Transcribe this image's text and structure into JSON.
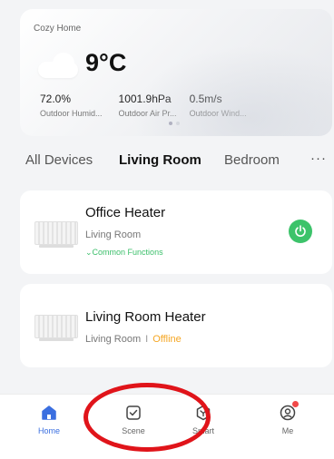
{
  "weather": {
    "home_name": "Cozy Home",
    "temperature": "9°C",
    "icon": "cloud-icon",
    "stats": [
      {
        "value": "72.0%",
        "label": "Outdoor Humid..."
      },
      {
        "value": "1001.9hPa",
        "label": "Outdoor Air Pr..."
      },
      {
        "value": "0.5m/s",
        "label": "Outdoor Wind..."
      }
    ]
  },
  "tabs": {
    "items": [
      "All Devices",
      "Living Room",
      "Bedroom"
    ],
    "active": "Living Room",
    "more": "···"
  },
  "devices": [
    {
      "name": "Office Heater",
      "room": "Living Room",
      "extra": "⌄Common Functions",
      "power": "on",
      "power_color": "#3cc36a"
    },
    {
      "name": "Living Room Heater",
      "room": "Living Room",
      "separator": "I",
      "status": "Offline",
      "status_color": "#f5a623"
    }
  ],
  "nav": {
    "items": [
      {
        "label": "Home",
        "icon": "home-icon",
        "active": true
      },
      {
        "label": "Scene",
        "icon": "scene-check-icon"
      },
      {
        "label": "Smart",
        "icon": "smart-hex-icon"
      },
      {
        "label": "Me",
        "icon": "profile-icon",
        "badge": true
      }
    ],
    "active_color": "#3b6fe0"
  },
  "annotation": {
    "color": "#e0141a",
    "target": "Scene"
  }
}
